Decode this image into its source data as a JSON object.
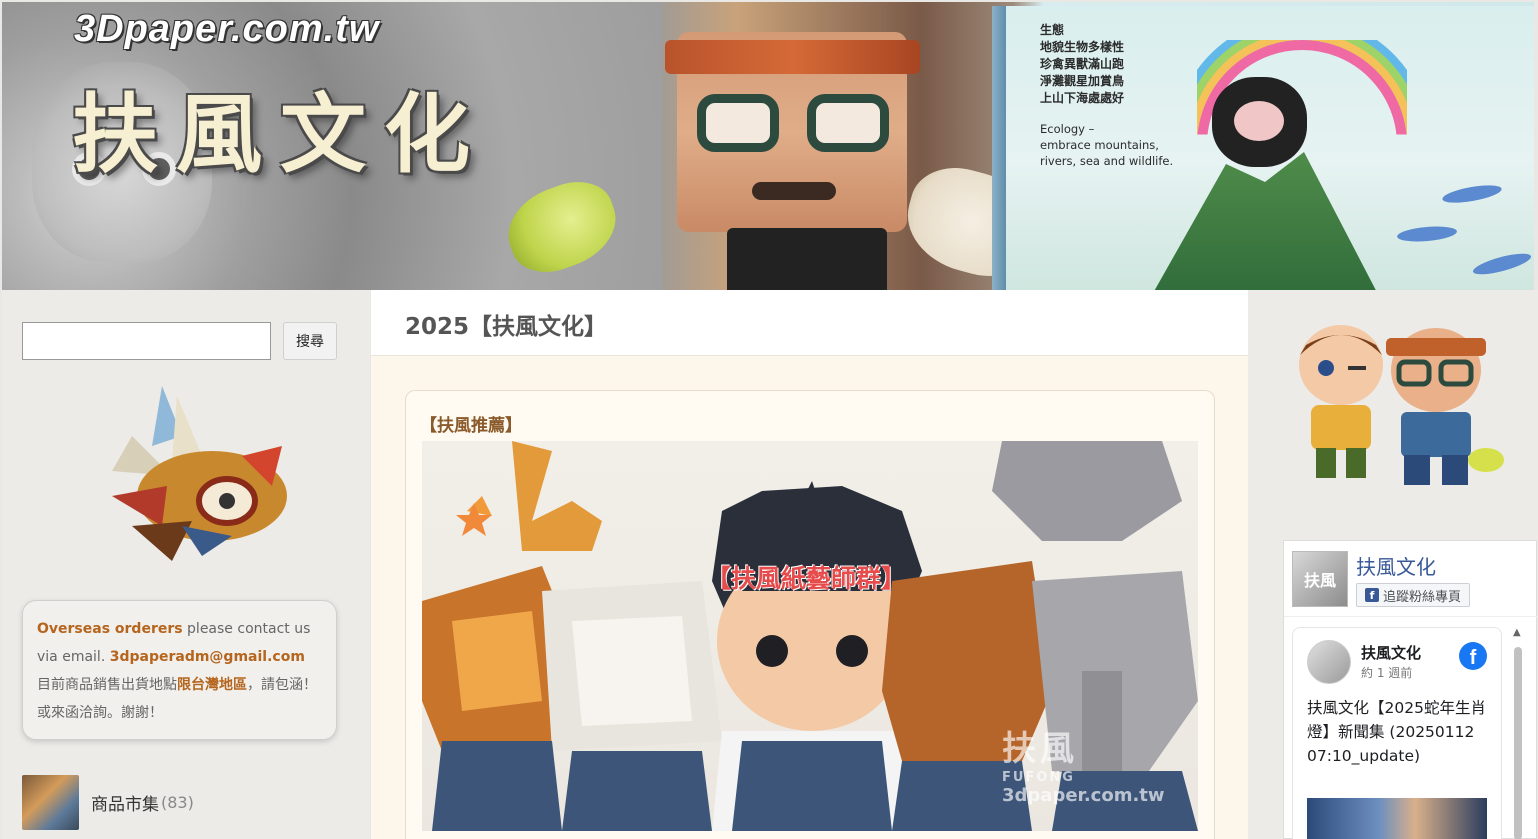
{
  "header": {
    "site_url": "3Dpaper.com.tw",
    "brand": "扶風文化",
    "book_text": {
      "heading": "生態",
      "lines": [
        "地貌生物多樣性",
        "珍禽異獸滿山跑",
        "淨灘觀星加賞鳥",
        "上山下海處處好"
      ],
      "english": [
        "Ecology –",
        "embrace mountains,",
        "rivers, sea and wildlife."
      ]
    }
  },
  "sidebar_left": {
    "search_button": "搜尋",
    "search_placeholder": "",
    "contact": {
      "highlight_overseas": "Overseas orderers",
      "text_1": " please contact us via email. ",
      "email": "3dpaperadm@gmail.com",
      "text_2": "目前商品銷售出貨地點",
      "highlight_region": "限台灣地區",
      "text_3": "，請包涵！或來函洽詢。謝謝！"
    },
    "category": {
      "label": "商品市集",
      "count": "(83)"
    }
  },
  "main": {
    "title": "2025【扶風文化】",
    "post": {
      "tag": "【扶風推薦】",
      "image_overlay": "【扶風紙藝師群】",
      "watermark_brand": "扶風",
      "watermark_sub": "FUFONG",
      "watermark_url": "3dpaper.com.tw"
    }
  },
  "sidebar_right": {
    "facebook": {
      "page_name": "扶風文化",
      "follow_button": "追蹤粉絲專頁",
      "logo_text": "扶風",
      "post_author": "扶風文化",
      "post_time": "約 1 週前",
      "post_text": "扶風文化【2025蛇年生肖燈】新聞集 (20250112 07:10_update)",
      "fb_letter": "f",
      "mini_letter": "f"
    }
  },
  "colors": {
    "accent_orange": "#b5651d",
    "title_gray": "#555555",
    "fb_blue": "#1877f2",
    "overlay_red": "#e74c4c"
  }
}
